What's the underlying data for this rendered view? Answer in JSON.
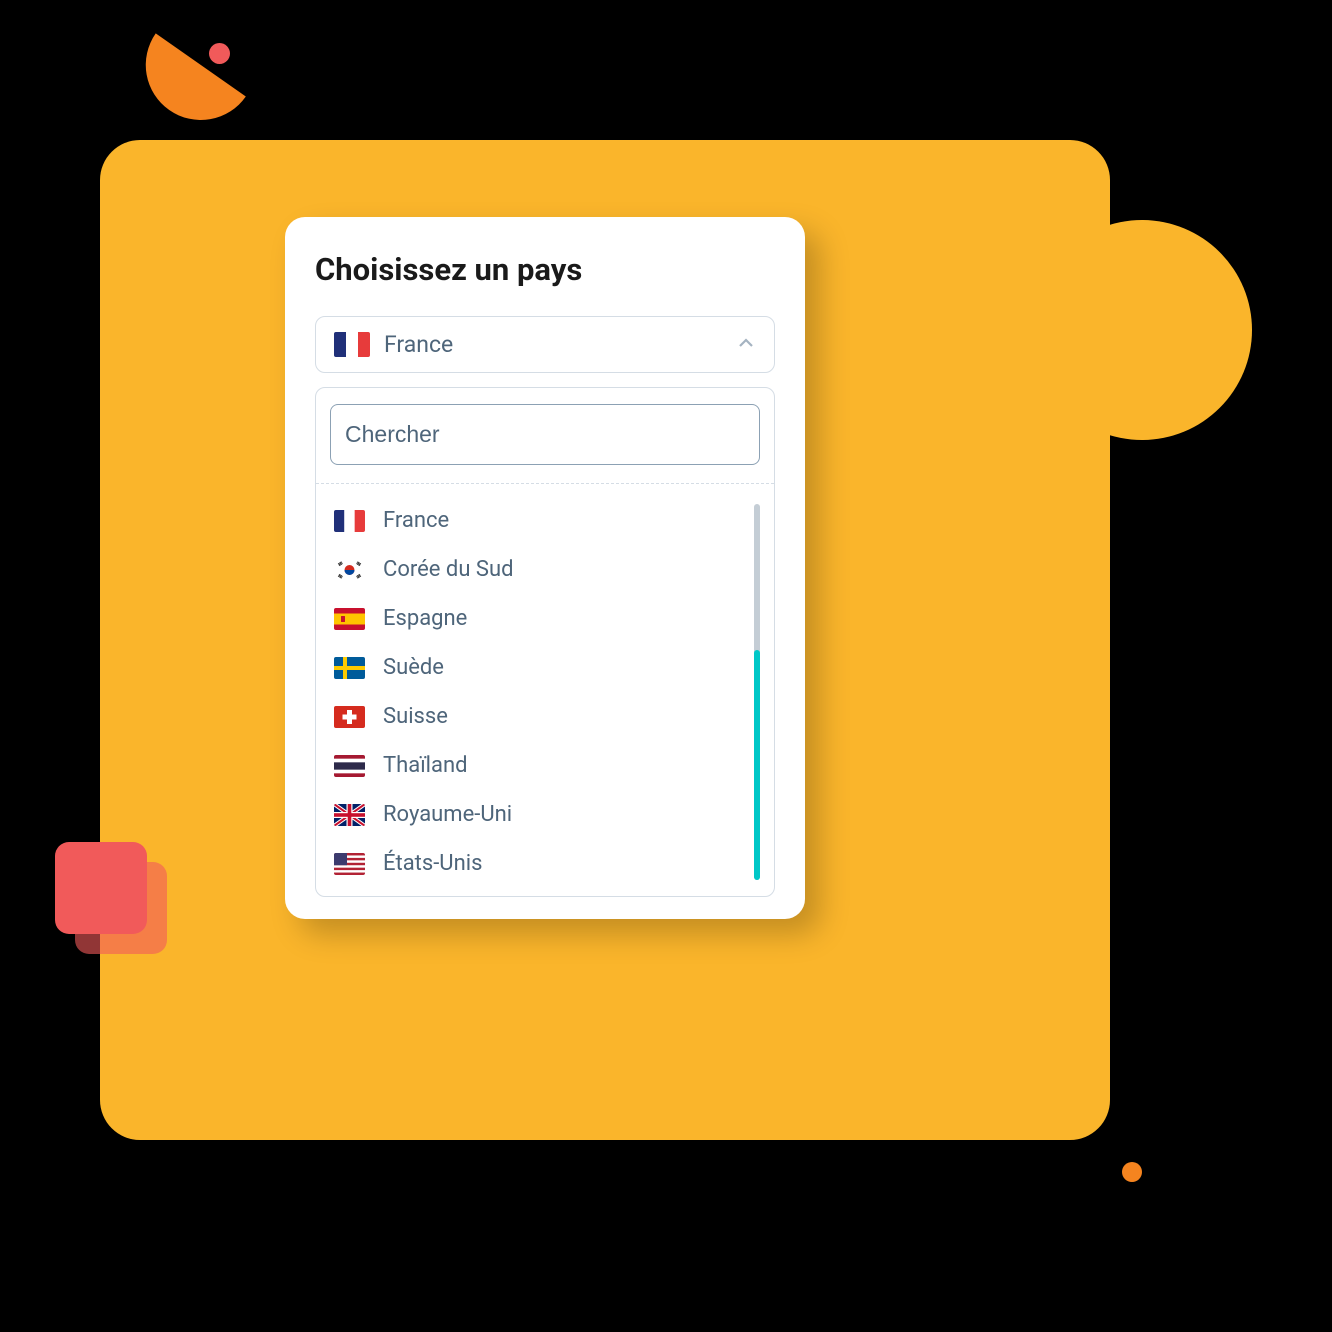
{
  "title": "Choisissez un pays",
  "selected": "France",
  "search_placeholder": "Chercher",
  "countries": [
    {
      "code": "fr",
      "name": "France"
    },
    {
      "code": "kr",
      "name": "Corée du Sud"
    },
    {
      "code": "es",
      "name": "Espagne"
    },
    {
      "code": "se",
      "name": "Suède"
    },
    {
      "code": "ch",
      "name": "Suisse"
    },
    {
      "code": "th",
      "name": "Thaïland"
    },
    {
      "code": "gb",
      "name": "Royaume-Uni"
    },
    {
      "code": "us",
      "name": "États-Unis"
    }
  ]
}
